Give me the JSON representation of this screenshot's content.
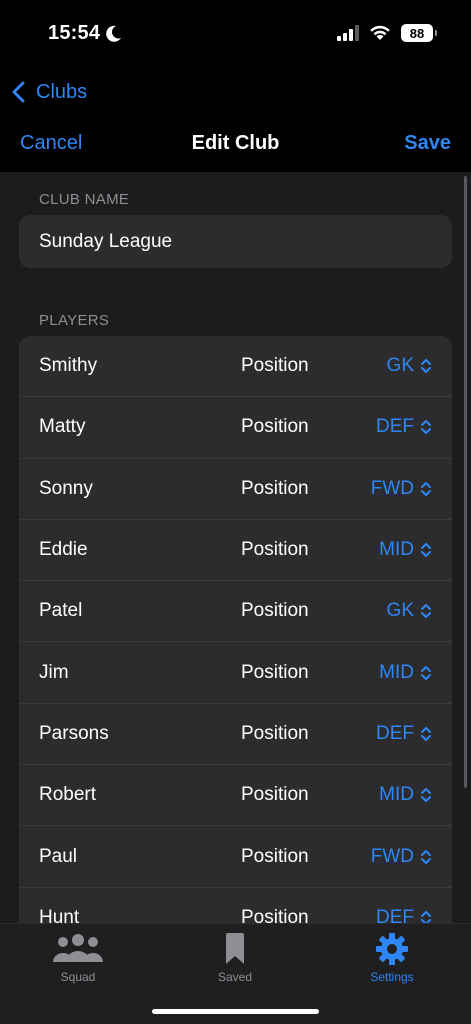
{
  "status_bar": {
    "time": "15:54",
    "battery": "88"
  },
  "nav": {
    "back_label": "Clubs"
  },
  "header": {
    "cancel_label": "Cancel",
    "title": "Edit Club",
    "save_label": "Save"
  },
  "club_name": {
    "label": "CLUB NAME",
    "value": "Sunday League"
  },
  "players": {
    "label": "PLAYERS",
    "items": [
      {
        "name": "Smithy",
        "position_label": "Position",
        "position": "GK"
      },
      {
        "name": "Matty",
        "position_label": "Position",
        "position": "DEF"
      },
      {
        "name": "Sonny",
        "position_label": "Position",
        "position": "FWD"
      },
      {
        "name": "Eddie",
        "position_label": "Position",
        "position": "MID"
      },
      {
        "name": "Patel",
        "position_label": "Position",
        "position": "GK"
      },
      {
        "name": "Jim",
        "position_label": "Position",
        "position": "MID"
      },
      {
        "name": "Parsons",
        "position_label": "Position",
        "position": "DEF"
      },
      {
        "name": "Robert",
        "position_label": "Position",
        "position": "MID"
      },
      {
        "name": "Paul",
        "position_label": "Position",
        "position": "FWD"
      },
      {
        "name": "Hunt",
        "position_label": "Position",
        "position": "DEF"
      }
    ]
  },
  "tab_bar": {
    "tabs": [
      {
        "label": "Squad",
        "icon": "people-icon",
        "active": false
      },
      {
        "label": "Saved",
        "icon": "bookmark-icon",
        "active": false
      },
      {
        "label": "Settings",
        "icon": "gear-icon",
        "active": true
      }
    ]
  },
  "colors": {
    "accent": "#2f86f5",
    "background": "#000000",
    "sheet": "#1c1c1e",
    "cell": "#2c2c2e"
  }
}
